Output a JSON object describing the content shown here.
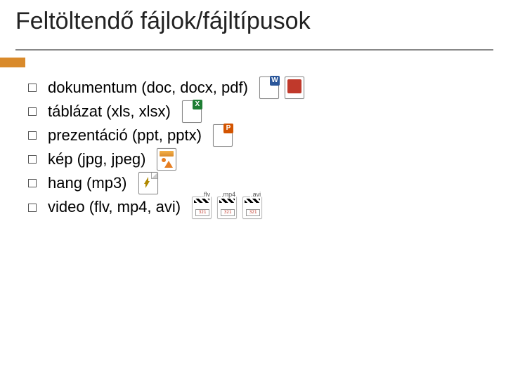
{
  "title": "Feltöltendő fájlok/fájltípusok",
  "items": [
    {
      "text": "dokumentum (doc, docx, pdf)",
      "icons": [
        "word",
        "pdf"
      ]
    },
    {
      "text": "táblázat (xls, xlsx)",
      "icons": [
        "excel"
      ]
    },
    {
      "text": "prezentáció (ppt, pptx)",
      "icons": [
        "ppt"
      ]
    },
    {
      "text": "kép (jpg, jpeg)",
      "icons": [
        "image"
      ]
    },
    {
      "text": "hang (mp3)",
      "icons": [
        "audio"
      ]
    },
    {
      "text": "video (flv, mp4, avi)",
      "icons": [
        "video-flv",
        "video-mp4",
        "video-avi"
      ]
    }
  ],
  "icon_to_label": {
    "word": "W",
    "pdf": "",
    "excel": "X",
    "ppt": "P",
    "video-flv": ".flv",
    "video-mp4": ".mp4",
    "video-avi": ".avi"
  }
}
